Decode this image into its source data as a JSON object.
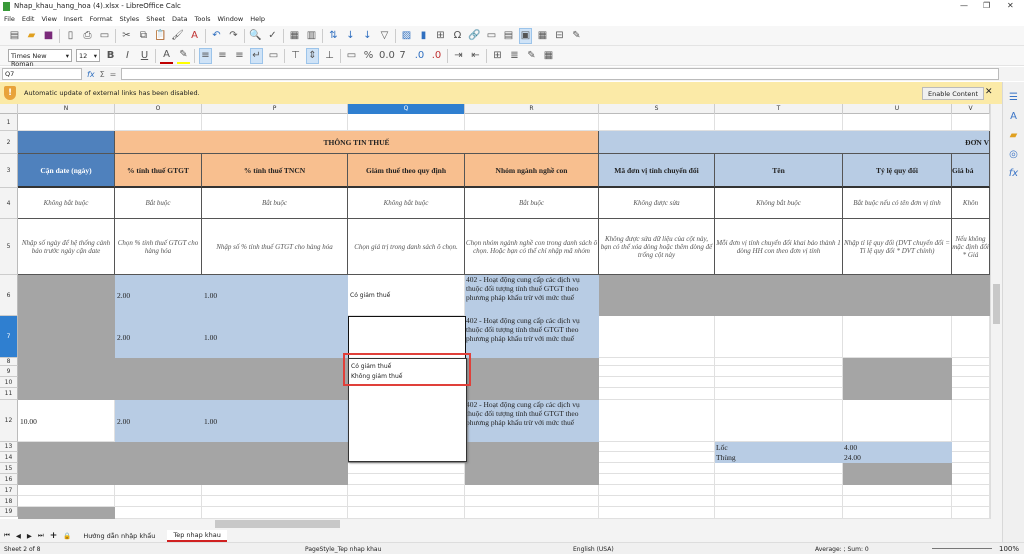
{
  "window": {
    "title": "Nhap_khau_hang_hoa (4).xlsx - LibreOffice Calc"
  },
  "menu": [
    "File",
    "Edit",
    "View",
    "Insert",
    "Format",
    "Styles",
    "Sheet",
    "Data",
    "Tools",
    "Window",
    "Help"
  ],
  "format": {
    "font": "Times New Roman",
    "size": "12"
  },
  "formula": {
    "cell": "Q7",
    "value": ""
  },
  "infobar": {
    "message": "Automatic update of external links has been disabled.",
    "button": "Enable Content"
  },
  "columns": [
    "N",
    "O",
    "P",
    "Q",
    "R",
    "S",
    "T",
    "U",
    "V"
  ],
  "rows": [
    "1",
    "2",
    "3",
    "4",
    "5",
    "6",
    "7",
    "8",
    "9",
    "10",
    "11",
    "12",
    "13",
    "14",
    "15",
    "16",
    "17",
    "18",
    "19"
  ],
  "header": {
    "group_tax": "THÔNG TIN THUẾ",
    "group_unit": "ĐƠN V",
    "N": "Cận date (ngày)",
    "O": "% tính thuế GTGT",
    "P": "% tính thuế TNCN",
    "Q": "Giảm thuế theo quy định",
    "R": "Nhóm ngành nghề con",
    "S": "Mã đơn vị tính chuyển đổi",
    "T": "Tên",
    "U": "Tỷ lệ quy đổi",
    "V": "Giá bá"
  },
  "required": {
    "N": "Không bắt buộc",
    "O": "Bắt buộc",
    "P": "Bắt buộc",
    "Q": "Không bắt buộc",
    "R": "Bắt buộc",
    "S": "Không được sửa",
    "T": "Không bắt buộc",
    "U": "Bắt buộc nếu có tên đơn vị tính",
    "V": "Khôn"
  },
  "hint": {
    "N": "Nhập số ngày để hệ thống cảnh báo trước ngày cận date",
    "O": "Chọn % tính thuế GTGT cho hàng hóa",
    "P": "Nhập số % tính thuế GTGT cho hàng hóa",
    "Q": "Chọn giá trị trong danh sách ô chọn.",
    "R": "Chọn nhóm ngành nghề con trong danh sách ô chọn. Hoặc bạn có thể chỉ nhập mã nhóm",
    "S": "Không được sửa dữ liệu của cột này, bạn có thể xóa dòng hoặc thêm dòng để trống cột này",
    "T": "Mỗi đơn vị tính chuyển đổi khai báo thành 1 dòng HH con theo đơn vị tính",
    "U": "Nhập tỉ lệ quy đổi (DVT chuyển đổi = Tỉ lệ quy đổi * DVT chính)",
    "V": "Nếu không mặc định đổi * Giá"
  },
  "data": {
    "O6": "2.00",
    "P6": "1.00",
    "Q6": "Có giảm thuế",
    "R6": "402 - Hoạt động cung cấp các dịch vụ thuộc đối tượng tính thuế GTGT theo phương pháp khấu trừ với mức thuế",
    "O7": "2.00",
    "P7": "1.00",
    "R7": "402 - Hoạt động cung cấp các dịch vụ thuộc đối tượng tính thuế GTGT theo phương pháp khấu trừ với mức thuế",
    "N12": "10.00",
    "O12": "2.00",
    "P12": "1.00",
    "R12": "402 - Hoạt động cung cấp các dịch vụ thuộc đối tượng tính thuế GTGT theo phương pháp khấu trừ với mức thuế",
    "T13": "Lốc",
    "U13": "4.00",
    "T14": "Thùng",
    "U14": "24.00"
  },
  "dropdown": {
    "options": [
      "Có giảm thuế",
      "Không giảm thuế"
    ]
  },
  "sheets": {
    "tabs": [
      "Hướng dẫn nhập khẩu",
      "Tep nhap khau"
    ],
    "active": "Tep nhap khau"
  },
  "status": {
    "sheet": "Sheet 2 of 8",
    "pagestyle": "PageStyle_Tep nhap khau",
    "language": "English (USA)",
    "summary": "Average: ; Sum: 0",
    "zoom": "100%"
  }
}
